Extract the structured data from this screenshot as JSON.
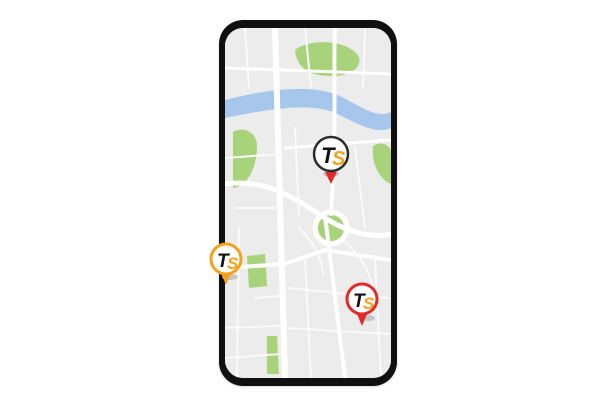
{
  "map": {
    "colors": {
      "land": "#ececec",
      "road": "#ffffff",
      "minor_road": "#f8f8f8",
      "water": "#a7c6ec",
      "park": "#a8d37a",
      "device_frame": "#101010"
    }
  },
  "markers": [
    {
      "id": "marker-top",
      "logo_text": "TS",
      "ring_color": "#2b2b2b",
      "logo_colors": {
        "T": "#111111",
        "S": "#f2a31b"
      },
      "tip_color": "#e02b2b",
      "shadow": true
    },
    {
      "id": "marker-left",
      "logo_text": "TS",
      "ring_color": "#f2a31b",
      "logo_colors": {
        "T": "#111111",
        "S": "#f2a31b"
      },
      "tip_color": "#f2a31b",
      "shadow": true
    },
    {
      "id": "marker-right",
      "logo_text": "TS",
      "ring_color": "#e02b2b",
      "logo_colors": {
        "T": "#111111",
        "S": "#f2a31b"
      },
      "tip_color": "#e02b2b",
      "shadow": true
    }
  ]
}
